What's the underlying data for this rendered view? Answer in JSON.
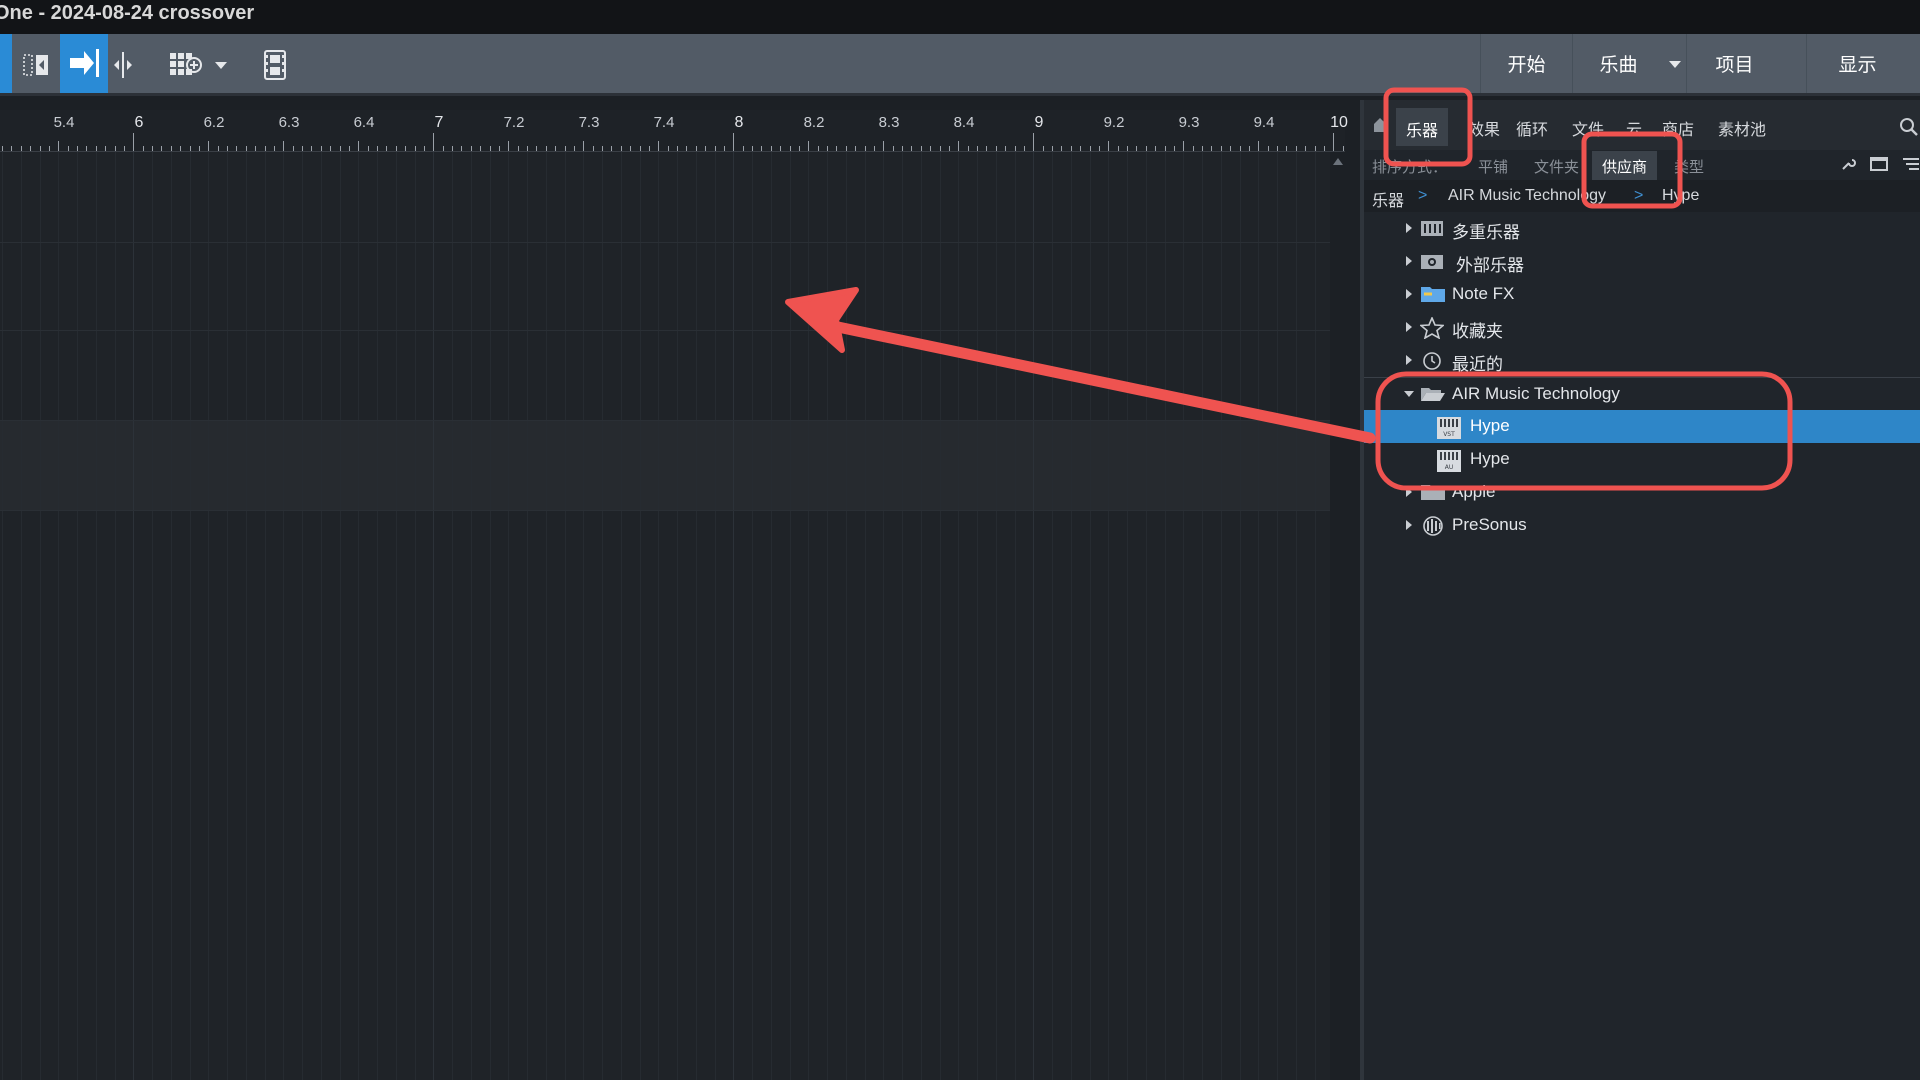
{
  "window": {
    "title": "One - 2024-08-24 crossover"
  },
  "toolbar": {
    "nav": [
      {
        "label": "开始"
      },
      {
        "label": "乐曲"
      },
      {
        "label": "项目"
      },
      {
        "label": "显示"
      }
    ]
  },
  "ruler": {
    "labels": [
      {
        "text": "5.4",
        "major": false
      },
      {
        "text": "6",
        "major": true
      },
      {
        "text": "6.2",
        "major": false
      },
      {
        "text": "6.3",
        "major": false
      },
      {
        "text": "6.4",
        "major": false
      },
      {
        "text": "7",
        "major": true
      },
      {
        "text": "7.2",
        "major": false
      },
      {
        "text": "7.3",
        "major": false
      },
      {
        "text": "7.4",
        "major": false
      },
      {
        "text": "8",
        "major": true
      },
      {
        "text": "8.2",
        "major": false
      },
      {
        "text": "8.3",
        "major": false
      },
      {
        "text": "8.4",
        "major": false
      },
      {
        "text": "9",
        "major": true
      },
      {
        "text": "9.2",
        "major": false
      },
      {
        "text": "9.3",
        "major": false
      },
      {
        "text": "9.4",
        "major": false
      },
      {
        "text": "10",
        "major": true
      }
    ]
  },
  "browser": {
    "tabs": [
      {
        "label": "乐器",
        "active": true
      },
      {
        "label": "效果",
        "active": false
      },
      {
        "label": "循环",
        "active": false
      },
      {
        "label": "文件",
        "active": false
      },
      {
        "label": "云",
        "active": false
      },
      {
        "label": "商店",
        "active": false
      },
      {
        "label": "素材池",
        "active": false
      }
    ],
    "sort_label": "排序方式：",
    "sort_options": [
      {
        "label": "平铺",
        "active": false
      },
      {
        "label": "文件夹",
        "active": false
      },
      {
        "label": "供应商",
        "active": true
      },
      {
        "label": "类型",
        "active": false
      }
    ],
    "breadcrumb": [
      "乐器",
      "AIR Music Technology",
      "Hype"
    ],
    "breadcrumb_sep": ">",
    "tree": [
      {
        "label": "多重乐器",
        "icon": "multi-instrument-icon",
        "state": "closed",
        "level": 0
      },
      {
        "label": "外部乐器",
        "icon": "external-instrument-icon",
        "state": "closed",
        "level": 0
      },
      {
        "label": "Note FX",
        "icon": "folder-icon",
        "state": "closed",
        "level": 0
      },
      {
        "label": "收藏夹",
        "icon": "star-icon",
        "state": "closed",
        "level": 0
      },
      {
        "label": "最近的",
        "icon": "clock-icon",
        "state": "closed",
        "level": 0
      },
      {
        "label": "AIR Music Technology",
        "icon": "open-folder-icon",
        "state": "open",
        "level": 0
      },
      {
        "label": "Hype",
        "icon": "vst-plugin-icon",
        "state": "none",
        "level": 1,
        "selected": true
      },
      {
        "label": "Hype",
        "icon": "au-plugin-icon",
        "state": "none",
        "level": 1,
        "selected": false
      },
      {
        "label": "Apple",
        "icon": "folder-icon",
        "state": "closed",
        "level": 0
      },
      {
        "label": "PreSonus",
        "icon": "presonus-icon",
        "state": "closed",
        "level": 0
      }
    ]
  },
  "annotations": {
    "color": "#ef5350"
  }
}
